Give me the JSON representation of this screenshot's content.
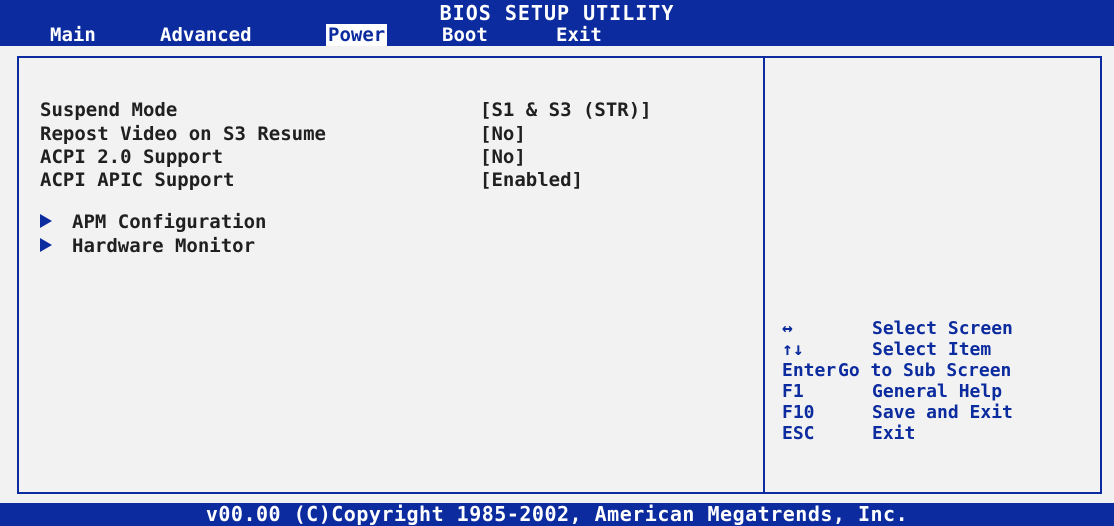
{
  "header": {
    "title": "BIOS SETUP UTILITY",
    "tabs": [
      {
        "label": "Main"
      },
      {
        "label": "Advanced"
      },
      {
        "label": "Power"
      },
      {
        "label": "Boot"
      },
      {
        "label": "Exit"
      }
    ],
    "active_tab": "Power"
  },
  "settings": [
    {
      "label": "Suspend Mode",
      "value": "[S1 & S3 (STR)]"
    },
    {
      "label": "Repost Video on S3 Resume",
      "value": "[No]"
    },
    {
      "label": "ACPI 2.0 Support",
      "value": "[No]"
    },
    {
      "label": "ACPI APIC Support",
      "value": "[Enabled]"
    }
  ],
  "submenus": [
    {
      "label": "APM Configuration"
    },
    {
      "label": "Hardware Monitor"
    }
  ],
  "help": [
    {
      "key": "↔",
      "desc": "Select Screen"
    },
    {
      "key": "↑↓",
      "desc": "Select Item"
    },
    {
      "key": "Enter",
      "desc": "Go to Sub Screen"
    },
    {
      "key": "F1",
      "desc": "General Help"
    },
    {
      "key": "F10",
      "desc": "Save and Exit"
    },
    {
      "key": "ESC",
      "desc": "Exit"
    }
  ],
  "footer": {
    "text": "v00.00 (C)Copyright 1985-2002, American Megatrends, Inc."
  },
  "colors": {
    "accent": "#0b2b9e",
    "background": "#f2f2f2",
    "text": "#202020"
  }
}
